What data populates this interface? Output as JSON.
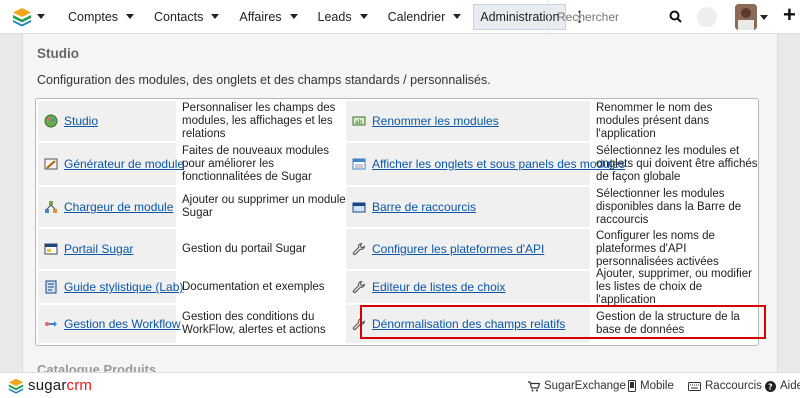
{
  "nav": {
    "items": [
      "Comptes",
      "Contacts",
      "Affaires",
      "Leads",
      "Calendrier"
    ],
    "active_item": "Administration",
    "search_placeholder": "Rechercher"
  },
  "studio": {
    "title": "Studio",
    "description": "Configuration des modules, des onglets et des champs standards / personnalisés.",
    "rows": [
      {
        "left_link": "Studio",
        "left_icon": "studio-icon",
        "left_desc": "Personnaliser les champs des modules, les affichages et les relations",
        "right_link": "Renommer les modules",
        "right_icon": "rename-modules-icon",
        "right_desc": "Renommer le nom des modules présent dans l'application"
      },
      {
        "left_link": "Générateur de module",
        "left_icon": "module-builder-icon",
        "left_desc": "Faites de nouveaux modules pour améliorer les fonctionnalitées de Sugar",
        "right_link": "Afficher les onglets et sous panels des modules",
        "right_icon": "tabs-subpanels-icon",
        "right_desc": "Sélectionnez les modules et onglets qui doivent être affichés de façon globale"
      },
      {
        "left_link": "Chargeur de module",
        "left_icon": "module-loader-icon",
        "left_desc": "Ajouter ou supprimer un module Sugar",
        "right_link": "Barre de raccourcis",
        "right_icon": "shortcut-bar-icon",
        "right_desc": "Sélectionner les modules disponibles dans la Barre de raccourcis"
      },
      {
        "left_link": "Portail Sugar",
        "left_icon": "portal-icon",
        "left_desc": "Gestion du portail Sugar",
        "right_link": "Configurer les plateformes d'API",
        "right_icon": "wrench-icon",
        "right_desc": "Configurer les noms de plateformes d'API personnalisées activées"
      },
      {
        "left_link": "Guide stylistique (Lab)",
        "left_icon": "style-guide-icon",
        "left_desc": "Documentation et exemples",
        "right_link": "Editeur de listes de choix",
        "right_icon": "wrench-icon",
        "right_desc": "Ajouter, supprimer, ou modifier les listes de choix de l'application"
      },
      {
        "left_link": "Gestion des Workflow",
        "left_icon": "workflow-icon",
        "left_desc": "Gestion des conditions du WorkFlow, alertes et actions",
        "right_link": "Dénormalisation des champs relatifs",
        "right_icon": "wrench-icon",
        "right_desc": "Gestion de la structure de la base de données"
      }
    ]
  },
  "next_section_title": "Catalogue Produits",
  "footer": {
    "brand_a": "sugar",
    "brand_b": "crm",
    "links": [
      "SugarExchange",
      "Mobile",
      "Raccourcis",
      "Aide"
    ]
  },
  "colors": {
    "link": "#0b57a8",
    "highlight": "#d40000",
    "brand_red": "#e61718"
  }
}
